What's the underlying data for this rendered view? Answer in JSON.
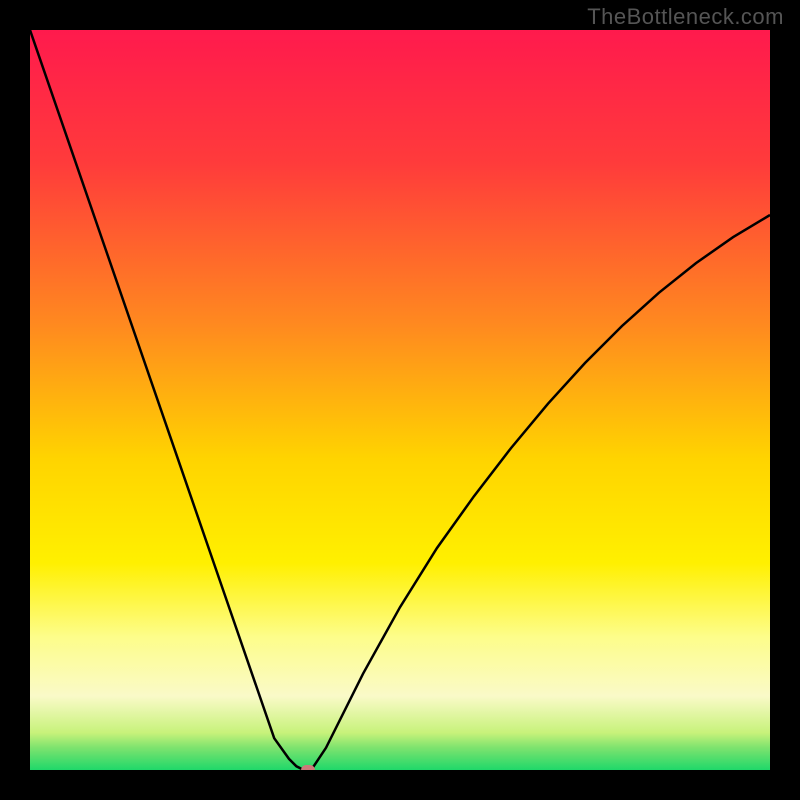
{
  "watermark": "TheBottleneck.com",
  "chart_data": {
    "type": "line",
    "title": "",
    "xlabel": "",
    "ylabel": "",
    "xlim": [
      0,
      100
    ],
    "ylim": [
      0,
      100
    ],
    "gradient_stops": [
      {
        "offset": 0,
        "color": "#ff1a4d"
      },
      {
        "offset": 18,
        "color": "#ff3b3b"
      },
      {
        "offset": 40,
        "color": "#ff8a1f"
      },
      {
        "offset": 58,
        "color": "#ffd400"
      },
      {
        "offset": 72,
        "color": "#fff000"
      },
      {
        "offset": 82,
        "color": "#fdfd8a"
      },
      {
        "offset": 90,
        "color": "#fafac8"
      },
      {
        "offset": 95,
        "color": "#c7f27a"
      },
      {
        "offset": 97,
        "color": "#7de36e"
      },
      {
        "offset": 100,
        "color": "#1fd86a"
      }
    ],
    "series": [
      {
        "name": "bottleneck-curve",
        "x": [
          0,
          5,
          10,
          15,
          20,
          25,
          30,
          33,
          35,
          36,
          37,
          38,
          40,
          45,
          50,
          55,
          60,
          65,
          70,
          75,
          80,
          85,
          90,
          95,
          100
        ],
        "y": [
          100,
          85.5,
          71,
          56.5,
          42,
          27.5,
          13,
          4.3,
          1.5,
          0.5,
          0,
          0,
          3,
          13,
          22,
          30,
          37,
          43.5,
          49.5,
          55,
          60,
          64.5,
          68.5,
          72,
          75
        ]
      }
    ],
    "marker": {
      "x": 37.5,
      "y": 0,
      "color": "#cc7a7a"
    }
  }
}
